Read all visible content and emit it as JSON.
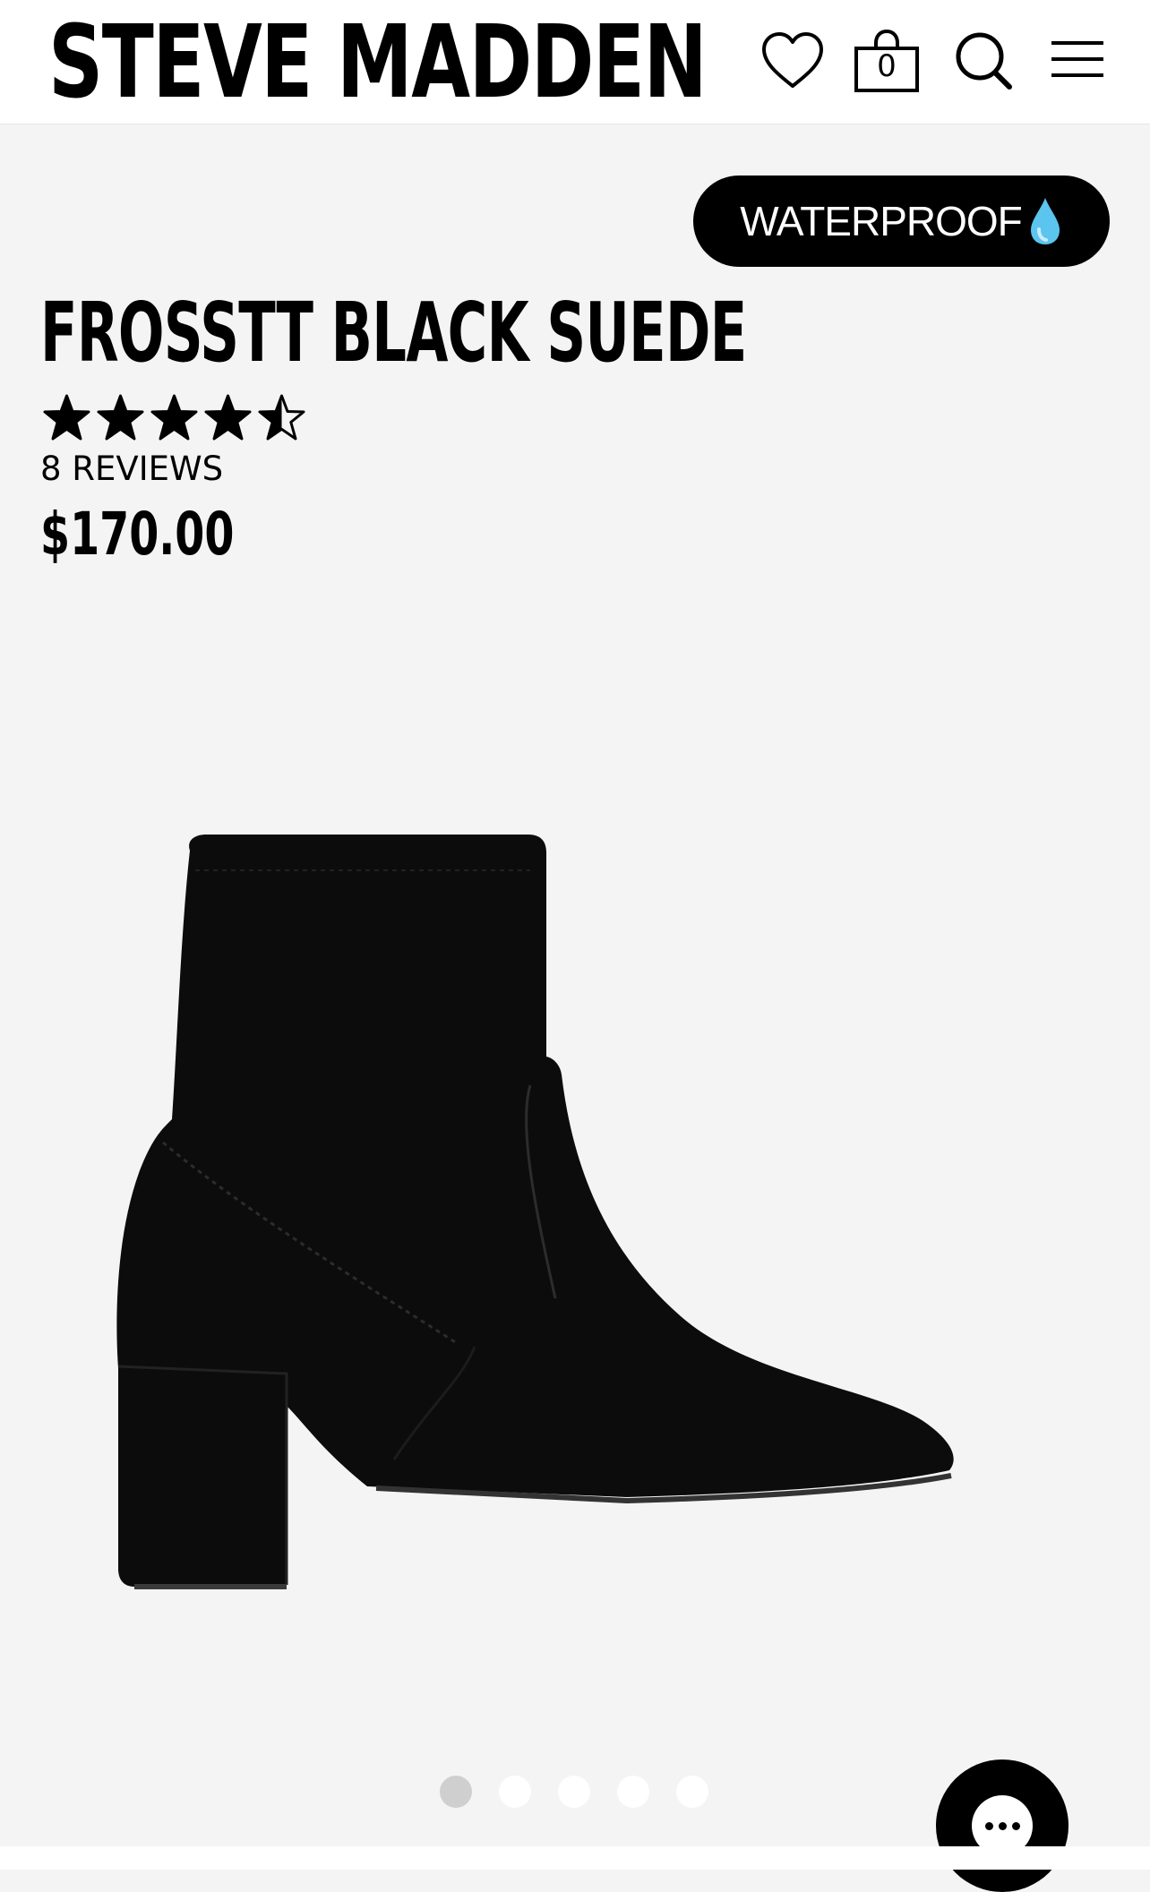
{
  "header": {
    "brand": "STEVE MADDEN",
    "bag_count": "0",
    "icons": [
      "heart-icon",
      "shopping-bag-icon",
      "search-icon",
      "menu-icon"
    ]
  },
  "product": {
    "badge": "WATERPROOF",
    "name": "FROSSTT BLACK SUEDE",
    "rating": 4.5,
    "rating_max": 5,
    "reviews_label": "8 REVIEWS",
    "price": "$170.00"
  },
  "gallery": {
    "image_count": 5,
    "active_index": 0
  },
  "colors": {
    "background": "#f4f4f4",
    "header": "#ffffff",
    "text": "#000000",
    "drop": "#5bc4ef",
    "dot_active": "#cfcfcf",
    "dot_inactive": "#ffffff"
  }
}
